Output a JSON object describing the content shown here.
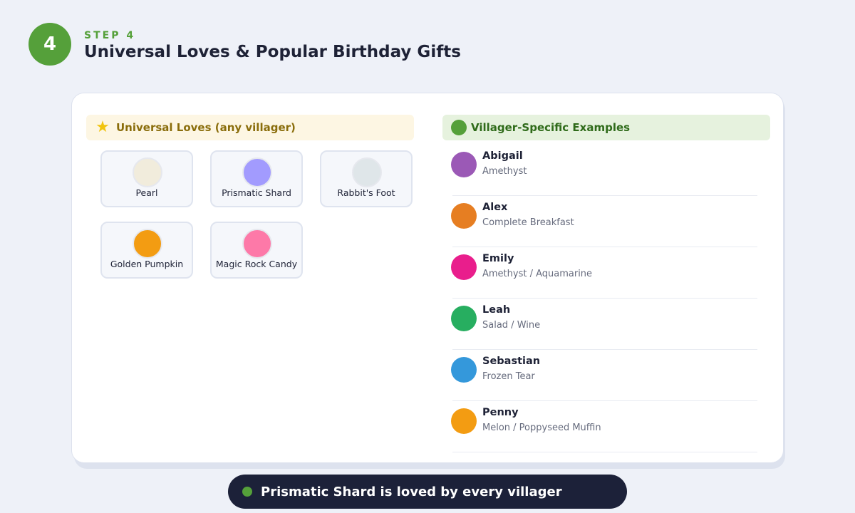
{
  "header": {
    "step_number": "4",
    "step_label": "STEP 4",
    "title": "Universal Loves & Popular Birthday Gifts"
  },
  "universal": {
    "title": "Universal Loves (any villager)",
    "icon": "star-icon",
    "items": [
      {
        "name": "Pearl",
        "color": "#f1ecdc"
      },
      {
        "name": "Prismatic Shard",
        "color": "#a29bfe"
      },
      {
        "name": "Rabbit's Foot",
        "color": "#dfe6e9"
      },
      {
        "name": "Golden Pumpkin",
        "color": "#f39c12"
      },
      {
        "name": "Magic Rock Candy",
        "color": "#fd79a8"
      }
    ]
  },
  "villagers": {
    "title": "Villager-Specific Examples",
    "items": [
      {
        "name": "Abigail",
        "gift": "Amethyst",
        "color": "#9b59b6"
      },
      {
        "name": "Alex",
        "gift": "Complete Breakfast",
        "color": "#e67e22"
      },
      {
        "name": "Emily",
        "gift": "Amethyst / Aquamarine",
        "color": "#e91e8c"
      },
      {
        "name": "Leah",
        "gift": "Salad / Wine",
        "color": "#27ae60"
      },
      {
        "name": "Sebastian",
        "gift": "Frozen Tear",
        "color": "#3498db"
      },
      {
        "name": "Penny",
        "gift": "Melon / Poppyseed Muffin",
        "color": "#f39c12"
      }
    ]
  },
  "footer": {
    "text": "Prismatic Shard is loved by every villager"
  },
  "colors": {
    "accent": "#55a03a",
    "footer_bg": "#1c2139"
  }
}
